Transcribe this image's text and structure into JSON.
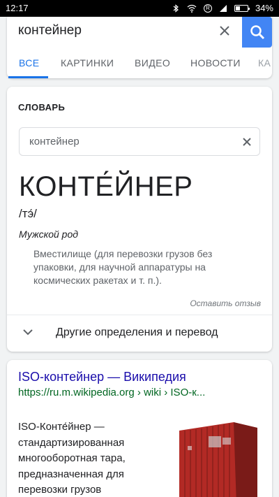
{
  "status_bar": {
    "time": "12:17",
    "battery": "34%"
  },
  "search": {
    "query": "контейнер"
  },
  "tabs": [
    {
      "label": "ВСЕ"
    },
    {
      "label": "КАРТИНКИ"
    },
    {
      "label": "ВИДЕО"
    },
    {
      "label": "НОВОСТИ"
    },
    {
      "label": "КА"
    }
  ],
  "dictionary": {
    "header": "СЛОВАРЬ",
    "input_value": "контейнер",
    "headword": "КОНТЕ́ЙНЕР",
    "phonetic": "/тэ́/",
    "part_of_speech": "Мужской род",
    "definition": "Вместилище (для перевозки грузов без упаковки, для научной аппаратуры на космических ракетах и т. п.).",
    "feedback_link": "Оставить отзыв",
    "more_label": "Другие определения и перевод"
  },
  "result": {
    "title": "ISO-контейнер — Википедия",
    "url": "https://ru.m.wikipedia.org › wiki › ISO-к...",
    "snippet": "ISO-Конте́йнер — стандартизированная многооборотная тара, предназначенная для перевозки грузов"
  },
  "colors": {
    "accent": "#1a73e8",
    "search_button": "#4285f4",
    "link": "#1a0dab",
    "url": "#006621"
  }
}
